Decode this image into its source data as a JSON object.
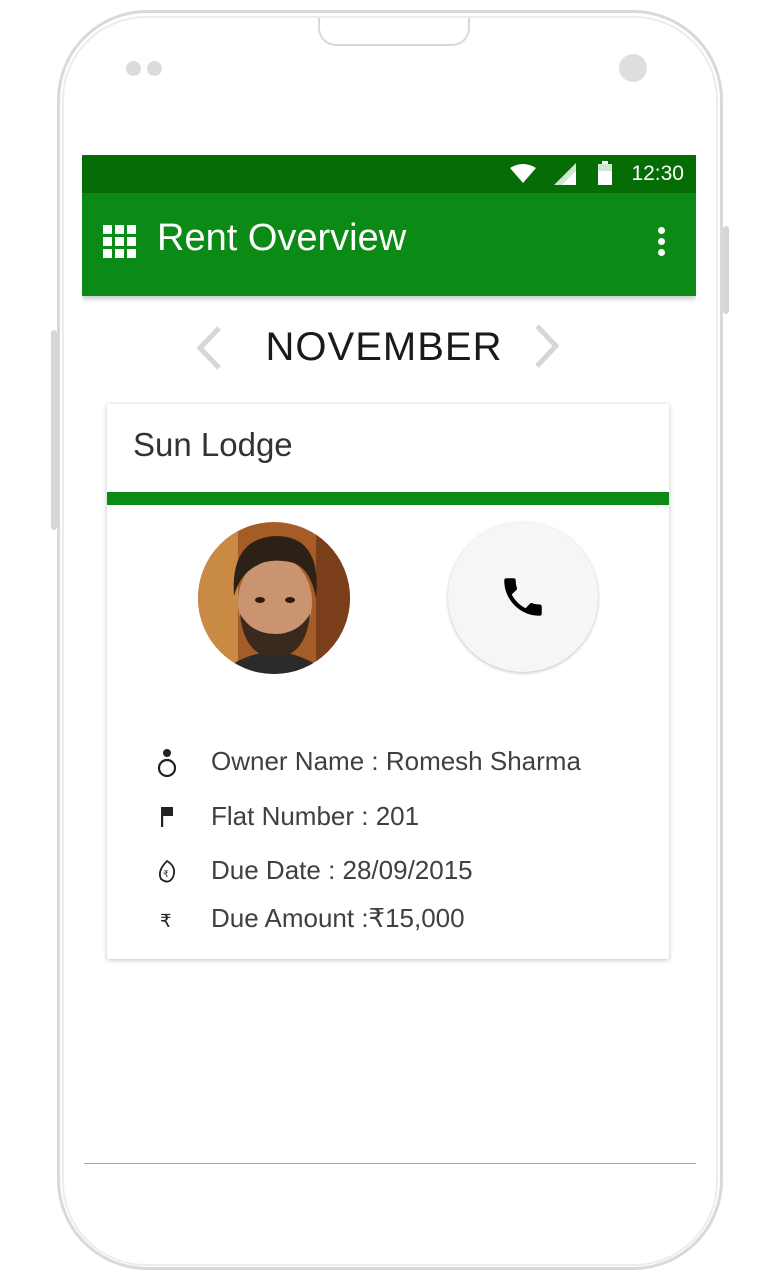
{
  "status_bar": {
    "time": "12:30"
  },
  "app_bar": {
    "title": "Rent Overview",
    "menu_icon": "grid-icon",
    "overflow_icon": "more-vert-icon"
  },
  "month_nav": {
    "month": "NOVEMBER",
    "prev_icon": "chevron-left-icon",
    "next_icon": "chevron-right-icon"
  },
  "card": {
    "title": "Sun Lodge",
    "accent_color": "#0b8a16",
    "call_icon": "phone-icon",
    "details": [
      {
        "icon": "person-icon",
        "text": "Owner Name : Romesh Sharma"
      },
      {
        "icon": "flag-icon",
        "text": "Flat Number : 201"
      },
      {
        "icon": "due-date-icon",
        "text": "Due Date : 28/09/2015"
      },
      {
        "icon": "rupee-icon",
        "text": "Due Amount :₹15,000"
      }
    ]
  },
  "colors": {
    "status_bar": "#066d06",
    "app_bar": "#0b8a16"
  }
}
